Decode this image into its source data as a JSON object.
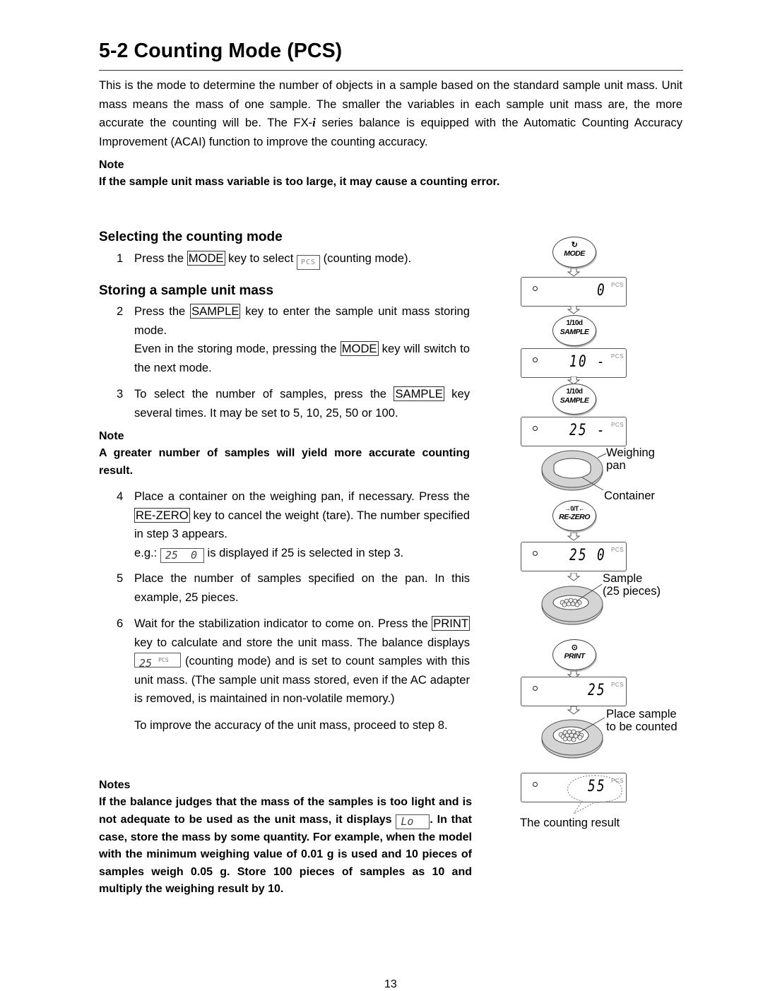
{
  "page": {
    "title": "5-2  Counting Mode (PCS)",
    "page_number": "13"
  },
  "intro": {
    "text_a": "This is the mode to determine the number of objects in a sample based on the standard sample unit mass. Unit mass means the mass of one sample. The smaller the variables in each sample unit mass are, the more accurate the counting will be. The FX-",
    "model_suffix": "i",
    "text_b": " series balance is equipped with the Automatic Counting Accuracy Improvement (ACAI) function to improve the counting accuracy."
  },
  "note1": {
    "label": "Note",
    "text": "If the sample unit mass variable is too large, it may cause a counting error."
  },
  "section1": {
    "heading": "Selecting the counting mode",
    "step1": {
      "num": "1",
      "t1": "Press the ",
      "key": "MODE",
      "t2": " key to select ",
      "display": "PCS",
      "t3": " (counting mode)."
    }
  },
  "section2": {
    "heading": "Storing a sample unit mass",
    "step2": {
      "num": "2",
      "t1": "Press the ",
      "key": "SAMPLE",
      "t2": " key to enter the sample unit mass storing mode.",
      "t3": "Even in the storing mode, pressing the ",
      "key2": "MODE",
      "t4": " key will switch to the next mode."
    },
    "step3": {
      "num": "3",
      "t1": "To select the number of samples, press the ",
      "key": "SAMPLE",
      "t2": " key several times. It may be set to 5, 10, 25, 50 or 100."
    },
    "note2": {
      "label": "Note",
      "text": "A greater number of samples will yield more accurate counting result."
    },
    "step4": {
      "num": "4",
      "t1": "Place a container on the weighing pan, if necessary. Press the ",
      "key": "RE-ZERO",
      "t2": " key to cancel the weight (tare). The number specified in step 3 appears.",
      "eg_prefix": "e.g.: ",
      "eg_display": "25  0",
      "eg_suffix": " is displayed if 25 is selected in step 3."
    },
    "step5": {
      "num": "5",
      "text": "Place the number of samples specified on the pan. In this example, 25 pieces."
    },
    "step6": {
      "num": "6",
      "t1": "Wait for the stabilization indicator to come on. Press the ",
      "key": "PRINT",
      "t2": " key to calculate and store the unit mass. The balance displays ",
      "display_value": "25",
      "display_unit": "PCS",
      "t3": " (counting mode) and is set to count samples with this unit mass. (The sample unit mass stored, even if the AC adapter is removed, is maintained in non-volatile memory.)",
      "followup": "To improve the accuracy of the unit mass, proceed to step 8."
    },
    "notes": {
      "label": "Notes",
      "t1": "If the balance judges that the mass of the samples is too light and is not adequate to be used as the unit mass, it displays ",
      "display": "Lo",
      "t2": ". In that case, store the mass by some quantity. For example, when the model with the minimum weighing value of 0.01 g is used and 10 pieces of samples weigh 0.05 g. Store 100 pieces of samples as 10 and multiply the weighing result by 10."
    }
  },
  "diagram": {
    "mode_button": {
      "symbol": "↻",
      "label": "MODE"
    },
    "sample_button": {
      "symbol": "1/10d",
      "label": "SAMPLE"
    },
    "rezero_button": {
      "symbol": "→0/T←",
      "label": "RE-ZERO"
    },
    "print_button": {
      "symbol": "⊙",
      "label": "PRINT"
    },
    "displays": [
      {
        "value": "0",
        "unit": "PCS"
      },
      {
        "value": "10 -",
        "unit": "PCS"
      },
      {
        "value": "25 -",
        "unit": "PCS"
      },
      {
        "value": "25 0",
        "unit": "PCS"
      },
      {
        "value": "25",
        "unit": "PCS"
      },
      {
        "value": "55",
        "unit": "PCS"
      }
    ],
    "callouts": {
      "weighing_pan": "Weighing\npan",
      "container": "Container",
      "sample": "Sample\n(25 pieces)",
      "place_sample": "Place sample\nto be counted",
      "counting_result": "The counting result"
    }
  }
}
